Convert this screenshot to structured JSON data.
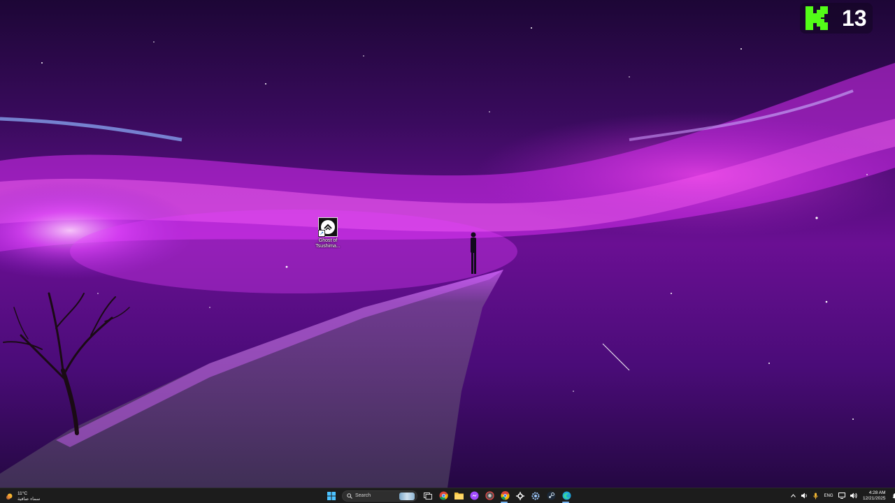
{
  "desktop": {
    "icons": [
      {
        "label": "Ghost of Tsushima...",
        "icon": "ghost-of-tsushima-icon"
      }
    ]
  },
  "overlay": {
    "brand_icon": "kick-logo-icon",
    "brand_color": "#53fc18",
    "count": "13"
  },
  "taskbar": {
    "weather": {
      "icon": "sun-icon",
      "temperature": "11°C",
      "condition": "سماء صافية"
    },
    "start_icon": "windows-start-icon",
    "search_placeholder": "Search",
    "pinned": [
      "task-view-icon",
      "chrome-icon",
      "file-explorer-icon",
      "messenger-icon",
      "chrome-alt-icon",
      "chrome-dev-icon",
      "steelseries-icon",
      "settings-icon",
      "steam-icon",
      "edge-icon"
    ],
    "tray": {
      "language": "ENG",
      "time": "4:28 AM",
      "date": "12/21/2025"
    }
  },
  "colors": {
    "taskbar_bg": "#1c1c1c",
    "accent": "#7ab8f5"
  }
}
